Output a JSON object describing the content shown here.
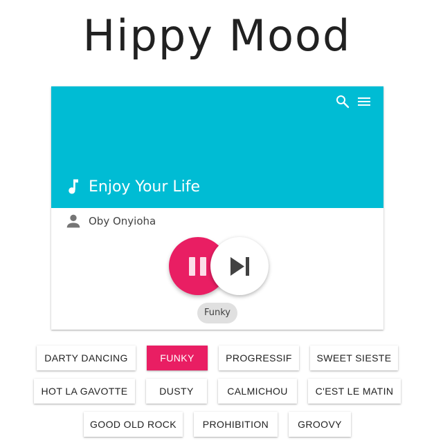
{
  "app": {
    "title": "Hippy Mood"
  },
  "player": {
    "song_title": "Enjoy Your Life",
    "artist": "Oby Onyioha",
    "current_mood": "Funky",
    "state": "playing",
    "icons": {
      "search": "search-icon",
      "menu": "menu-icon",
      "note": "music-note-icon",
      "artist": "person-icon",
      "pause": "pause-icon",
      "next": "skip-next-icon"
    }
  },
  "moods": [
    {
      "label": "DARTY DANCING",
      "active": false
    },
    {
      "label": "FUNKY",
      "active": true
    },
    {
      "label": "PROGRESSIF",
      "active": false
    },
    {
      "label": "SWEET SIESTE",
      "active": false
    },
    {
      "label": "HOT LA GAVOTTE",
      "active": false
    },
    {
      "label": "DUSTY",
      "active": false
    },
    {
      "label": "CALMICHOU",
      "active": false
    },
    {
      "label": "C'EST LE MATIN",
      "active": false
    },
    {
      "label": "GOOD OLD ROCK",
      "active": false
    },
    {
      "label": "PROHIBITION",
      "active": false
    },
    {
      "label": "GROOVY",
      "active": false
    }
  ],
  "colors": {
    "header": "#00bcd4",
    "accent": "#e91e63",
    "chip": "#e0e0e0",
    "text": "#212121"
  }
}
